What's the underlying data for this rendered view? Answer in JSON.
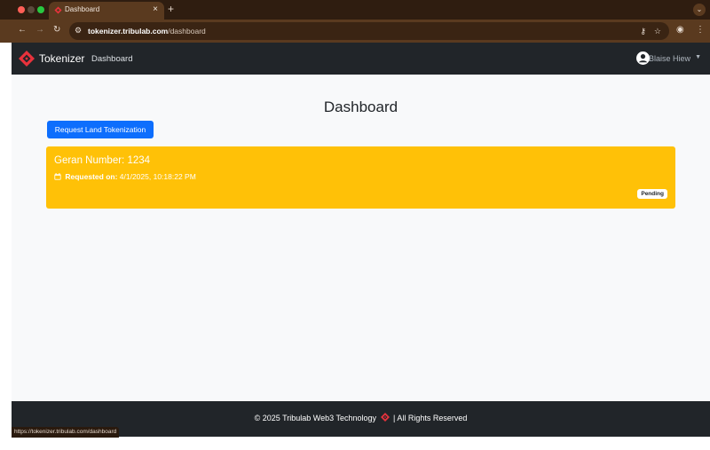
{
  "browser": {
    "tab_title": "Dashboard",
    "url_host": "tokenizer.tribulab.com",
    "url_path": "/dashboard",
    "status_url": "https://tokenizer.tribulab.com/dashboard"
  },
  "navbar": {
    "brand": "Tokenizer",
    "link": "Dashboard",
    "user_name": "Blaise Hiew"
  },
  "main": {
    "title": "Dashboard",
    "request_button": "Request Land Tokenization",
    "card": {
      "geran_label": "Geran Number: 1234",
      "requested_label": "Requested on:",
      "requested_value": "4/1/2025, 10:18:22 PM",
      "status": "Pending"
    }
  },
  "footer": {
    "text_left": "© 2025 Tribulab Web3 Technology",
    "text_right": "| All Rights Reserved"
  },
  "colors": {
    "brand_red": "#e8323c",
    "primary": "#0d6efd",
    "warning": "#ffc107",
    "dark": "#212529"
  },
  "icons": [
    "tokenizer-logo-icon",
    "user-circle-icon",
    "calendar-icon",
    "key-icon",
    "star-icon"
  ]
}
